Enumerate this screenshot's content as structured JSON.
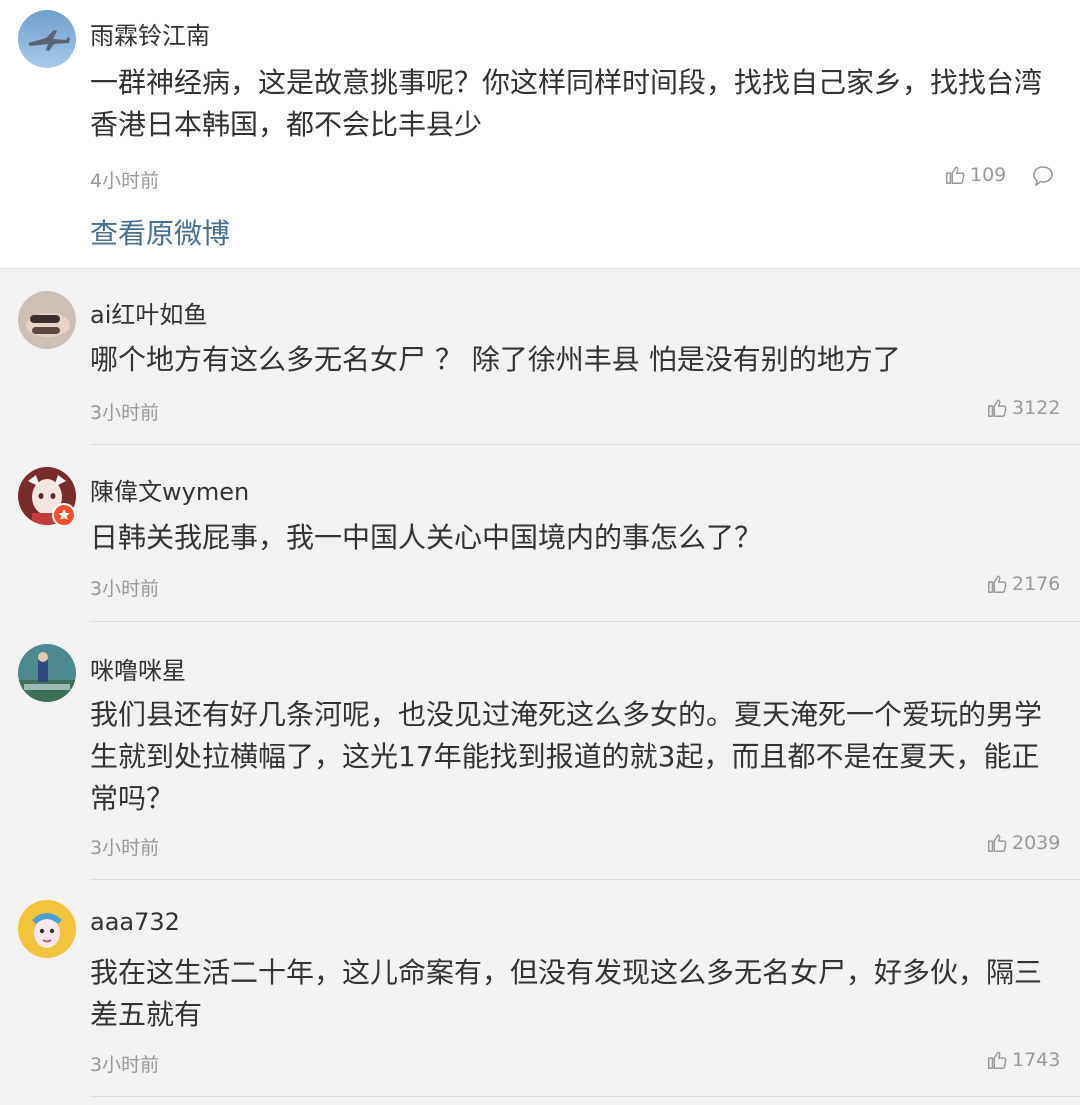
{
  "main_comment": {
    "username": "雨霖铃江南",
    "text": "一群神经病，这是故意挑事呢？你这样同样时间段，找找自己家乡，找找台湾香港日本韩国，都不会比丰县少",
    "time": "4小时前",
    "likes": "109",
    "avatar_icon": "fighter-jet-avatar",
    "view_original": "查看原微博"
  },
  "comments": [
    {
      "username": "ai红叶如鱼",
      "text": "哪个地方有这么多无名女尸 ？ 除了徐州丰县 怕是没有别的地方了",
      "time": "3小时前",
      "likes": "3122",
      "avatar_icon": "hand-photo-avatar"
    },
    {
      "username": "陳偉文wymen",
      "text": "日韩关我屁事，我一中国人关心中国境内的事怎么了？",
      "time": "3小时前",
      "likes": "2176",
      "avatar_icon": "anime-character-avatar",
      "badge_icon": "star-badge-icon"
    },
    {
      "username": "咪噜咪星",
      "text": "我们县还有好几条河呢，也没见过淹死这么多女的。夏天淹死一个爱玩的男学生就到处拉横幅了，这光17年能找到报道的就3起，而且都不是在夏天，能正常吗？",
      "time": "3小时前",
      "likes": "2039",
      "avatar_icon": "game-screen-avatar"
    },
    {
      "username": "aaa732",
      "text": "我在这生活二十年，这儿命案有，但没有发现这么多无名女尸，好多伙，隔三差五就有",
      "time": "3小时前",
      "likes": "1743",
      "avatar_icon": "opera-mask-avatar"
    }
  ],
  "colors": {
    "link": "#4a6f96",
    "muted": "#999999",
    "text": "#333333",
    "badge": "#f4512c"
  }
}
